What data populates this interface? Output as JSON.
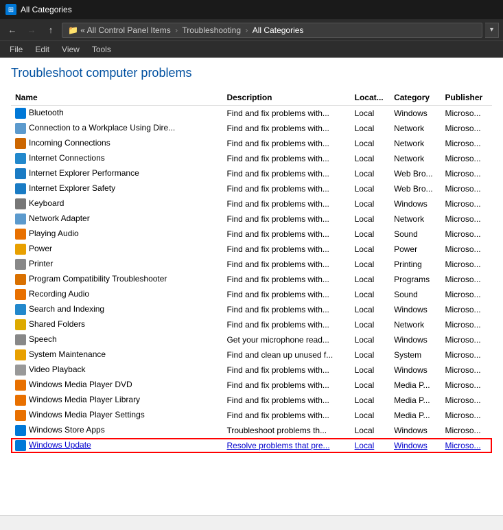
{
  "titleBar": {
    "icon": "folder",
    "title": "All Categories"
  },
  "addressBar": {
    "backLabel": "←",
    "forwardLabel": "→",
    "upLabel": "↑",
    "breadcrumb": [
      {
        "label": "All Control Panel Items",
        "sep": "›"
      },
      {
        "label": "Troubleshooting",
        "sep": "›"
      },
      {
        "label": "All Categories",
        "sep": ""
      }
    ],
    "dropdownLabel": "▾"
  },
  "menuBar": {
    "items": [
      "File",
      "Edit",
      "View",
      "Tools"
    ]
  },
  "pageTitle": "Troubleshoot computer problems",
  "tableHeaders": {
    "name": "Name",
    "description": "Description",
    "location": "Locat...",
    "category": "Category",
    "publisher": "Publisher"
  },
  "rows": [
    {
      "name": "Bluetooth",
      "desc": "Find and fix problems with...",
      "loc": "Local",
      "cat": "Windows",
      "pub": "Microso...",
      "highlight": false
    },
    {
      "name": "Connection to a Workplace Using Dire...",
      "desc": "Find and fix problems with...",
      "loc": "Local",
      "cat": "Network",
      "pub": "Microso...",
      "highlight": false
    },
    {
      "name": "Incoming Connections",
      "desc": "Find and fix problems with...",
      "loc": "Local",
      "cat": "Network",
      "pub": "Microso...",
      "highlight": false
    },
    {
      "name": "Internet Connections",
      "desc": "Find and fix problems with...",
      "loc": "Local",
      "cat": "Network",
      "pub": "Microso...",
      "highlight": false
    },
    {
      "name": "Internet Explorer Performance",
      "desc": "Find and fix problems with...",
      "loc": "Local",
      "cat": "Web Bro...",
      "pub": "Microso...",
      "highlight": false
    },
    {
      "name": "Internet Explorer Safety",
      "desc": "Find and fix problems with...",
      "loc": "Local",
      "cat": "Web Bro...",
      "pub": "Microso...",
      "highlight": false
    },
    {
      "name": "Keyboard",
      "desc": "Find and fix problems with...",
      "loc": "Local",
      "cat": "Windows",
      "pub": "Microso...",
      "highlight": false
    },
    {
      "name": "Network Adapter",
      "desc": "Find and fix problems with...",
      "loc": "Local",
      "cat": "Network",
      "pub": "Microso...",
      "highlight": false
    },
    {
      "name": "Playing Audio",
      "desc": "Find and fix problems with...",
      "loc": "Local",
      "cat": "Sound",
      "pub": "Microso...",
      "highlight": false
    },
    {
      "name": "Power",
      "desc": "Find and fix problems with...",
      "loc": "Local",
      "cat": "Power",
      "pub": "Microso...",
      "highlight": false
    },
    {
      "name": "Printer",
      "desc": "Find and fix problems with...",
      "loc": "Local",
      "cat": "Printing",
      "pub": "Microso...",
      "highlight": false
    },
    {
      "name": "Program Compatibility Troubleshooter",
      "desc": "Find and fix problems with...",
      "loc": "Local",
      "cat": "Programs",
      "pub": "Microso...",
      "highlight": false
    },
    {
      "name": "Recording Audio",
      "desc": "Find and fix problems with...",
      "loc": "Local",
      "cat": "Sound",
      "pub": "Microso...",
      "highlight": false
    },
    {
      "name": "Search and Indexing",
      "desc": "Find and fix problems with...",
      "loc": "Local",
      "cat": "Windows",
      "pub": "Microso...",
      "highlight": false
    },
    {
      "name": "Shared Folders",
      "desc": "Find and fix problems with...",
      "loc": "Local",
      "cat": "Network",
      "pub": "Microso...",
      "highlight": false
    },
    {
      "name": "Speech",
      "desc": "Get your microphone read...",
      "loc": "Local",
      "cat": "Windows",
      "pub": "Microso...",
      "highlight": false
    },
    {
      "name": "System Maintenance",
      "desc": "Find and clean up unused f...",
      "loc": "Local",
      "cat": "System",
      "pub": "Microso...",
      "highlight": false
    },
    {
      "name": "Video Playback",
      "desc": "Find and fix problems with...",
      "loc": "Local",
      "cat": "Windows",
      "pub": "Microso...",
      "highlight": false
    },
    {
      "name": "Windows Media Player DVD",
      "desc": "Find and fix problems with...",
      "loc": "Local",
      "cat": "Media P...",
      "pub": "Microso...",
      "highlight": false
    },
    {
      "name": "Windows Media Player Library",
      "desc": "Find and fix problems with...",
      "loc": "Local",
      "cat": "Media P...",
      "pub": "Microso...",
      "highlight": false
    },
    {
      "name": "Windows Media Player Settings",
      "desc": "Find and fix problems with...",
      "loc": "Local",
      "cat": "Media P...",
      "pub": "Microso...",
      "highlight": false
    },
    {
      "name": "Windows Store Apps",
      "desc": "Troubleshoot problems th...",
      "loc": "Local",
      "cat": "Windows",
      "pub": "Microso...",
      "highlight": false
    },
    {
      "name": "Windows Update",
      "desc": "Resolve problems that pre...",
      "loc": "Local",
      "cat": "Windows",
      "pub": "Microso...",
      "highlight": true
    }
  ],
  "iconColors": {
    "bluetooth": "#0078d7",
    "connection": "#5c9acd",
    "incoming": "#e8a000",
    "internetconn": "#6aa3d8",
    "ieperf": "#1f8ad0",
    "iesafety": "#1f8ad0",
    "keyboard": "#555",
    "network": "#5c9acd",
    "audio": "#e87000",
    "power": "#f0b000",
    "printer": "#555",
    "compat": "#e87000",
    "recording": "#e87000",
    "search": "#5c9acd",
    "shared": "#e8a000",
    "speech": "#555",
    "system": "#e8a000",
    "video": "#555",
    "dvd": "#e87000",
    "library": "#e87000",
    "settings": "#e87000",
    "store": "#0078d7",
    "update": "#0078d7"
  },
  "statusBar": {
    "text": ""
  }
}
